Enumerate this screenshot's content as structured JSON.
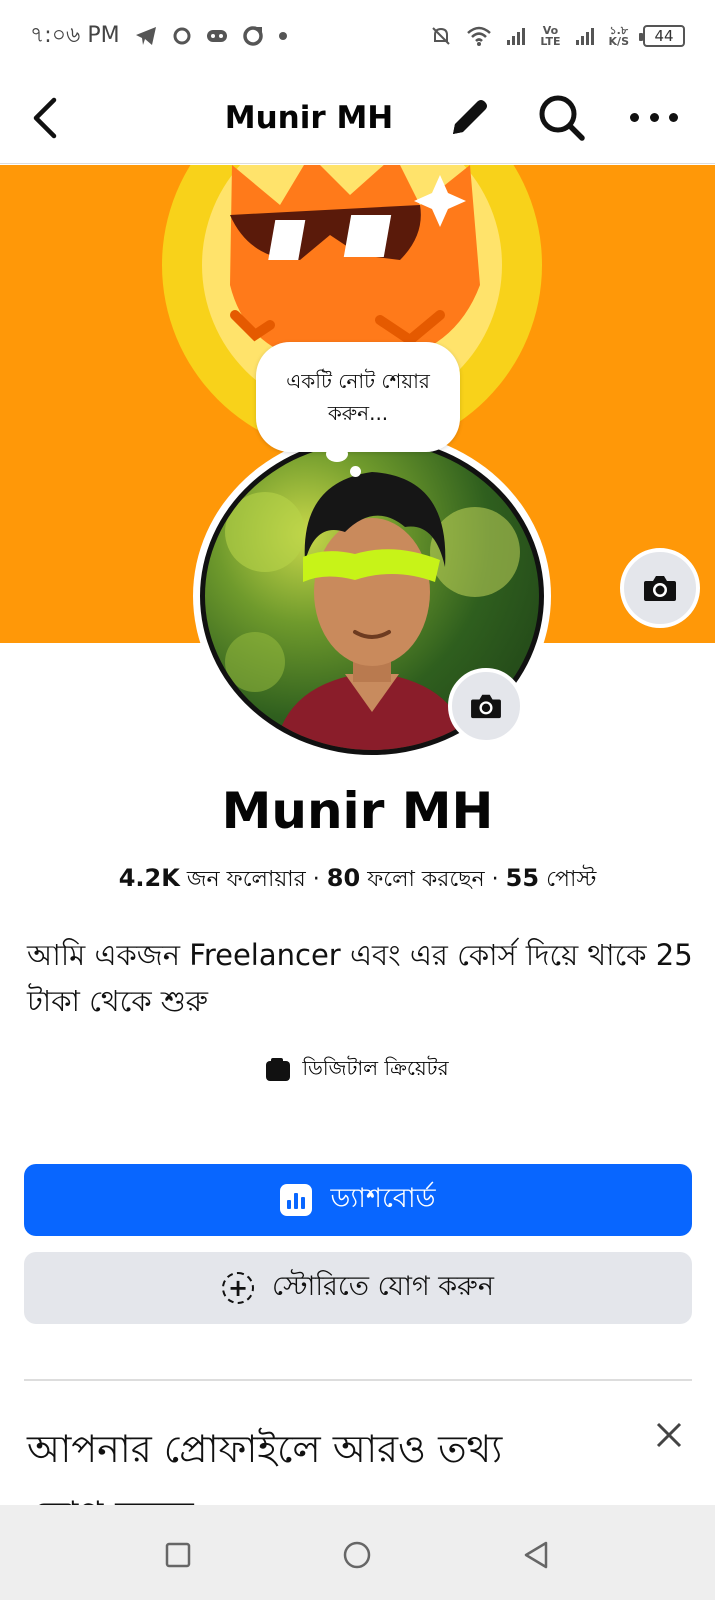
{
  "status_bar": {
    "time": "৭:০৬ PM",
    "volte_label": "Vo\nLTE",
    "network_speed": "১.৮",
    "speed_unit": "K/S",
    "battery": "44"
  },
  "nav": {
    "title": "Munir MH"
  },
  "note": {
    "text": "একটি নোট শেয়ার করুন..."
  },
  "profile": {
    "name": "Munir MH",
    "followers_count": "4.2K",
    "followers_label": "জন ফলোয়ার",
    "following_count": "80",
    "following_label": "ফলো করছেন",
    "posts_count": "55",
    "posts_label": "পোস্ট",
    "separator": "·",
    "bio": "আমি একজন Freelancer এবং এর কোর্স দিয়ে থাকে 25 টাকা থেকে শুরু",
    "category": "ডিজিটাল ক্রিয়েটর"
  },
  "buttons": {
    "dashboard": "ড্যাশবোর্ড",
    "add_story": "স্টোরিতে যোগ করুন"
  },
  "more_info": {
    "title": "আপনার প্রোফাইলে আরও তথ্য",
    "sub_partial": "যোগ করুন"
  },
  "colors": {
    "cover": "#ff9808",
    "primary": "#0866ff",
    "secondary_button": "#e4e6eb"
  },
  "icons": [
    "back-arrow-icon",
    "edit-pencil-icon",
    "search-icon",
    "more-icon",
    "camera-icon",
    "dashboard-icon",
    "add-story-icon",
    "close-icon"
  ]
}
